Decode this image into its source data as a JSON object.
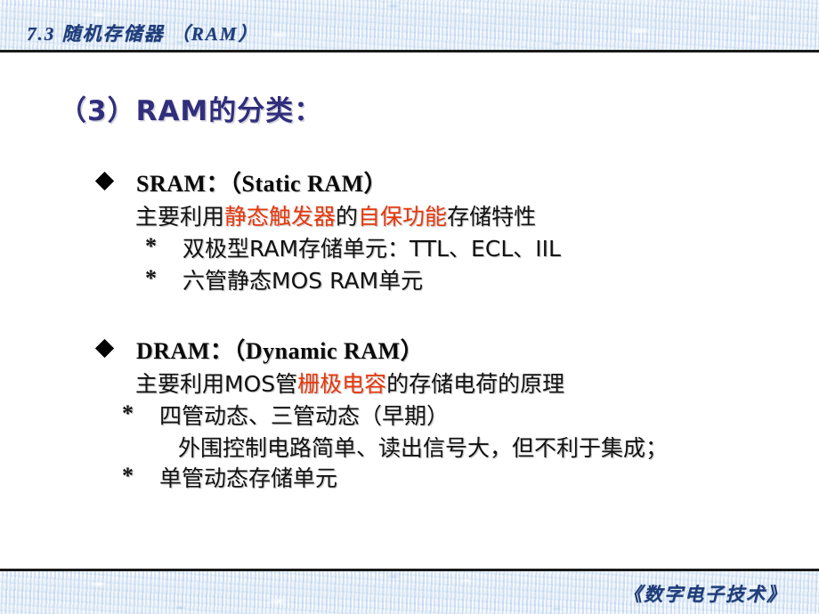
{
  "slide": {
    "header_title": "7.3  随机存储器 （RAM）",
    "footer_title": "《数字电子技术》",
    "section_heading": "（3）RAM的分类：",
    "colors": {
      "band_background": "#dfe9f5",
      "band_border": "#1a1a1a",
      "header_text": "#1f3d7a",
      "heading_text": "#312e7c",
      "body_text": "#121212",
      "highlight_red": "#e8380d",
      "slide_background": "#ffffff"
    }
  },
  "blocks": [
    {
      "id": "sram",
      "bullet_icon": "diamond-bullet-icon",
      "heading": "SRAM：（Static RAM）",
      "description_runs": [
        {
          "text": "主要利用",
          "color": "black"
        },
        {
          "text": "静态触发器",
          "color": "red"
        },
        {
          "text": "的",
          "color": "black"
        },
        {
          "text": "自保功能",
          "color": "red"
        },
        {
          "text": "存储特性",
          "color": "black"
        }
      ],
      "sub_items": [
        {
          "mark": "*",
          "text": "双极型RAM存储单元：TTL、ECL、IIL"
        },
        {
          "mark": "*",
          "text": "六管静态MOS RAM单元"
        }
      ]
    },
    {
      "id": "dram",
      "bullet_icon": "diamond-bullet-icon",
      "heading": "DRAM：（Dynamic RAM）",
      "description_runs": [
        {
          "text": "主要利用MOS管",
          "color": "black"
        },
        {
          "text": "栅极电容",
          "color": "red"
        },
        {
          "text": "的存储电荷的原理",
          "color": "black"
        }
      ],
      "sub_items": [
        {
          "mark": "*",
          "text": "四管动态、三管动态（早期）"
        },
        {
          "mark": "",
          "text": "外围控制电路简单、读出信号大，但不利于集成；"
        },
        {
          "mark": "*",
          "text": "单管动态存储单元"
        }
      ]
    }
  ]
}
